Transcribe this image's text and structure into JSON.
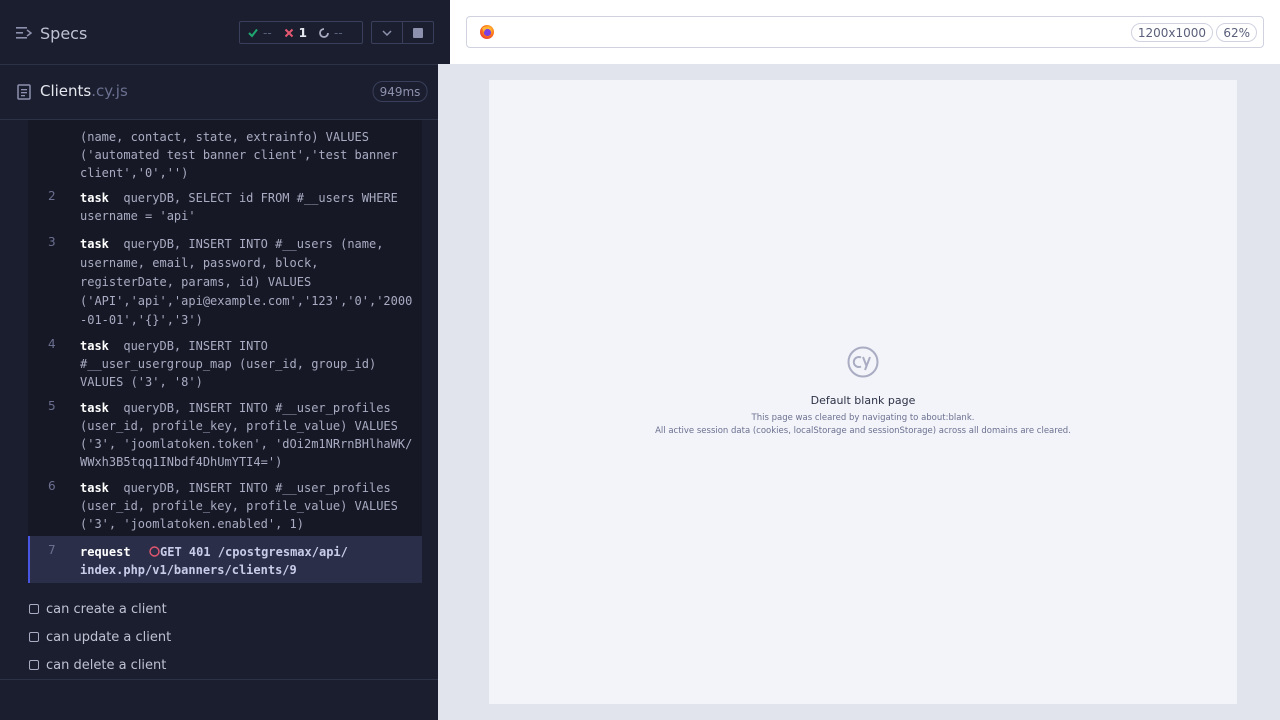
{
  "reporter": {
    "specs_label": "Specs",
    "stats": {
      "passed": "--",
      "failed": "1",
      "pending": "--"
    },
    "spec": {
      "name": "Clients",
      "ext": ".cy.js",
      "duration": "949ms"
    },
    "commands": [
      {
        "num": "",
        "name": "",
        "text": "(name, contact, state, extrainfo) VALUES\n('automated test banner client','test banner\nclient','0','')"
      },
      {
        "num": "2",
        "name": "task",
        "text": "queryDB, SELECT id FROM #__users WHERE\nusername = 'api'"
      },
      {
        "num": "3",
        "name": "task",
        "text": "queryDB, INSERT INTO #__users (name,\nusername, email, password, block,\nregisterDate, params, id) VALUES\n('API','api','api@example.com','123','0','2000\n-01-01','{}','3')"
      },
      {
        "num": "4",
        "name": "task",
        "text": "queryDB, INSERT INTO\n#__user_usergroup_map (user_id, group_id)\nVALUES ('3', '8')"
      },
      {
        "num": "5",
        "name": "task",
        "text": "queryDB, INSERT INTO #__user_profiles\n(user_id, profile_key, profile_value) VALUES\n('3', 'joomlatoken.token', 'dOi2m1NRrnBHlhaWK/\nWWxh3B5tqq1INbdf4DhUmYTI4=')"
      },
      {
        "num": "6",
        "name": "task",
        "text": "queryDB, INSERT INTO #__user_profiles\n(user_id, profile_key, profile_value) VALUES\n('3', 'joomlatoken.enabled', 1)"
      },
      {
        "num": "7",
        "name": "request",
        "text": "GET 401 /cpostgresmax/api/\nindex.php/v1/banners/clients/9"
      }
    ],
    "tests": [
      {
        "label": "can create a client"
      },
      {
        "label": "can update a client"
      },
      {
        "label": "can delete a client"
      }
    ]
  },
  "aut": {
    "viewport": "1200x1000",
    "zoom": "62%",
    "blank": {
      "title": "Default blank page",
      "line1": "This page was cleared by navigating to about:blank.",
      "line2": "All active session data (cookies, localStorage and sessionStorage) across all domains are cleared."
    }
  },
  "colors": {
    "passed": "#1fa971",
    "failed": "#e45770",
    "accent": "#4956e3",
    "pending_icon": "#a9acc2"
  },
  "icons": {
    "specs": "menu-icon",
    "passed": "check-icon",
    "failed": "x-icon",
    "pending": "spinner-icon",
    "expand": "chevron-down-icon",
    "stop": "stop-icon",
    "spec": "document-icon",
    "request_failed": "circle-icon",
    "browser": "firefox-icon",
    "blank": "cypress-logo-icon"
  }
}
